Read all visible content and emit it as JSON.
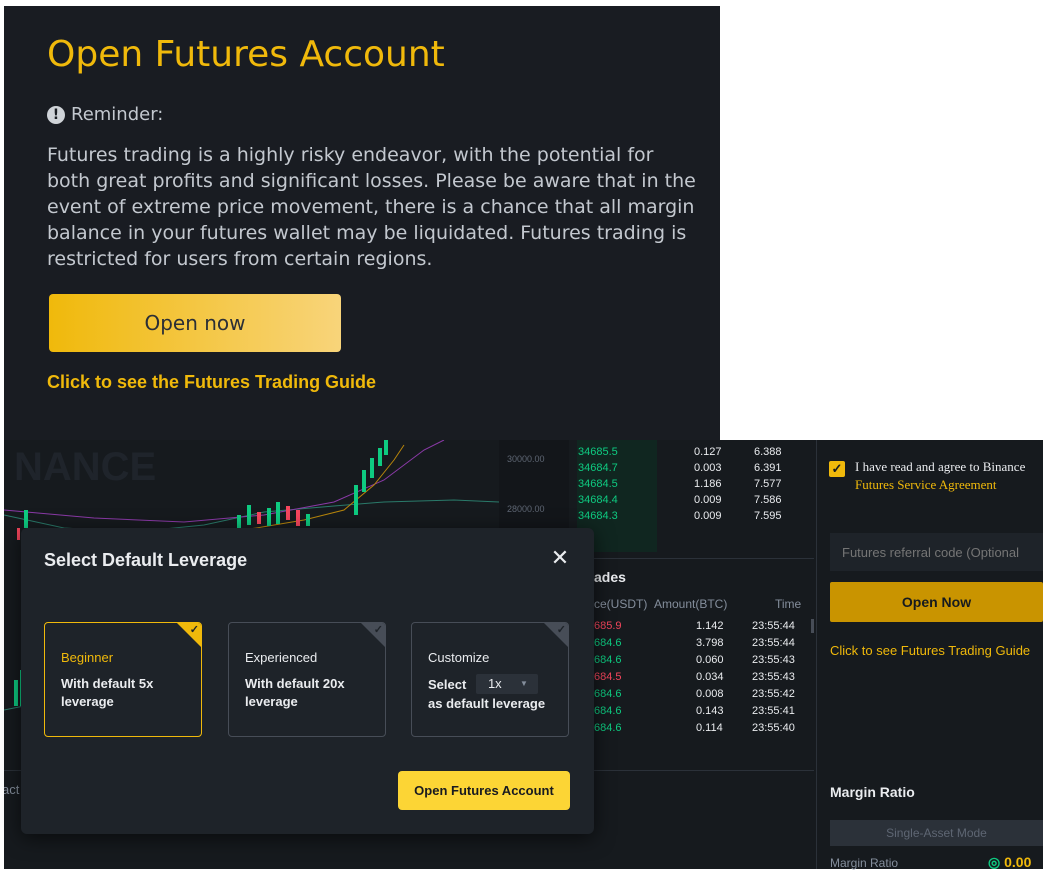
{
  "top_panel": {
    "title": "Open Futures Account",
    "reminder_label": "Reminder:",
    "reminder_text": "Futures trading is a highly risky endeavor, with the potential for both great profits and significant losses. Please be aware that in the event of extreme price movement, there is a chance that all margin balance in your futures wallet may be liquidated. Futures trading is restricted for users from certain regions.",
    "open_button": "Open now",
    "guide_link": "Click to see the Futures Trading Guide"
  },
  "background": {
    "watermark": "NANCE",
    "price_axis": [
      "30000.00",
      "28000.00"
    ],
    "orderbook": [
      {
        "price": "34685.5",
        "amount": "0.127",
        "total": "6.388"
      },
      {
        "price": "34684.7",
        "amount": "0.003",
        "total": "6.391"
      },
      {
        "price": "34684.5",
        "amount": "1.186",
        "total": "7.577"
      },
      {
        "price": "34684.4",
        "amount": "0.009",
        "total": "7.586"
      },
      {
        "price": "34684.3",
        "amount": "0.009",
        "total": "7.595"
      }
    ],
    "trades_title": "ades",
    "trades_headers": {
      "price": "ce(USDT)",
      "amount": "Amount(BTC)",
      "time": "Time"
    },
    "trades": [
      {
        "price": "685.9",
        "amount": "1.142",
        "time": "23:55:44",
        "side": "sell"
      },
      {
        "price": "684.6",
        "amount": "3.798",
        "time": "23:55:44",
        "side": "buy"
      },
      {
        "price": "684.6",
        "amount": "0.060",
        "time": "23:55:43",
        "side": "buy"
      },
      {
        "price": "684.5",
        "amount": "0.034",
        "time": "23:55:43",
        "side": "sell"
      },
      {
        "price": "684.6",
        "amount": "0.008",
        "time": "23:55:42",
        "side": "buy"
      },
      {
        "price": "684.6",
        "amount": "0.143",
        "time": "23:55:41",
        "side": "buy"
      },
      {
        "price": "684.6",
        "amount": "0.114",
        "time": "23:55:40",
        "side": "buy"
      }
    ],
    "left_label": "act"
  },
  "right_panel": {
    "agree_prefix": "I have read and agree to Binance ",
    "agree_link": "Futures Service Agreement",
    "referral_placeholder": "Futures referral code (Optional",
    "open_button": "Open Now",
    "guide_link": "Click to see Futures Trading Guide",
    "margin_title": "Margin Ratio",
    "single_asset": "Single-Asset Mode",
    "margin_ratio_label": "Margin Ratio",
    "margin_ratio_value": "0.00"
  },
  "modal": {
    "title": "Select Default Leverage",
    "close": "✕",
    "options": [
      {
        "title": "Beginner",
        "desc": "With default 5x leverage",
        "selected": true
      },
      {
        "title": "Experienced",
        "desc": "With default 20x leverage",
        "selected": false
      },
      {
        "title": "Customize",
        "desc_prefix": "Select",
        "select_value": "1x",
        "desc_suffix": "as default leverage",
        "selected": false
      }
    ],
    "submit": "Open Futures Account"
  },
  "colors": {
    "accent": "#f0b90b",
    "button": "#fcd535",
    "green": "#0ecb81",
    "red": "#f6465d",
    "panel": "#191c22",
    "modal": "#1e2329"
  }
}
